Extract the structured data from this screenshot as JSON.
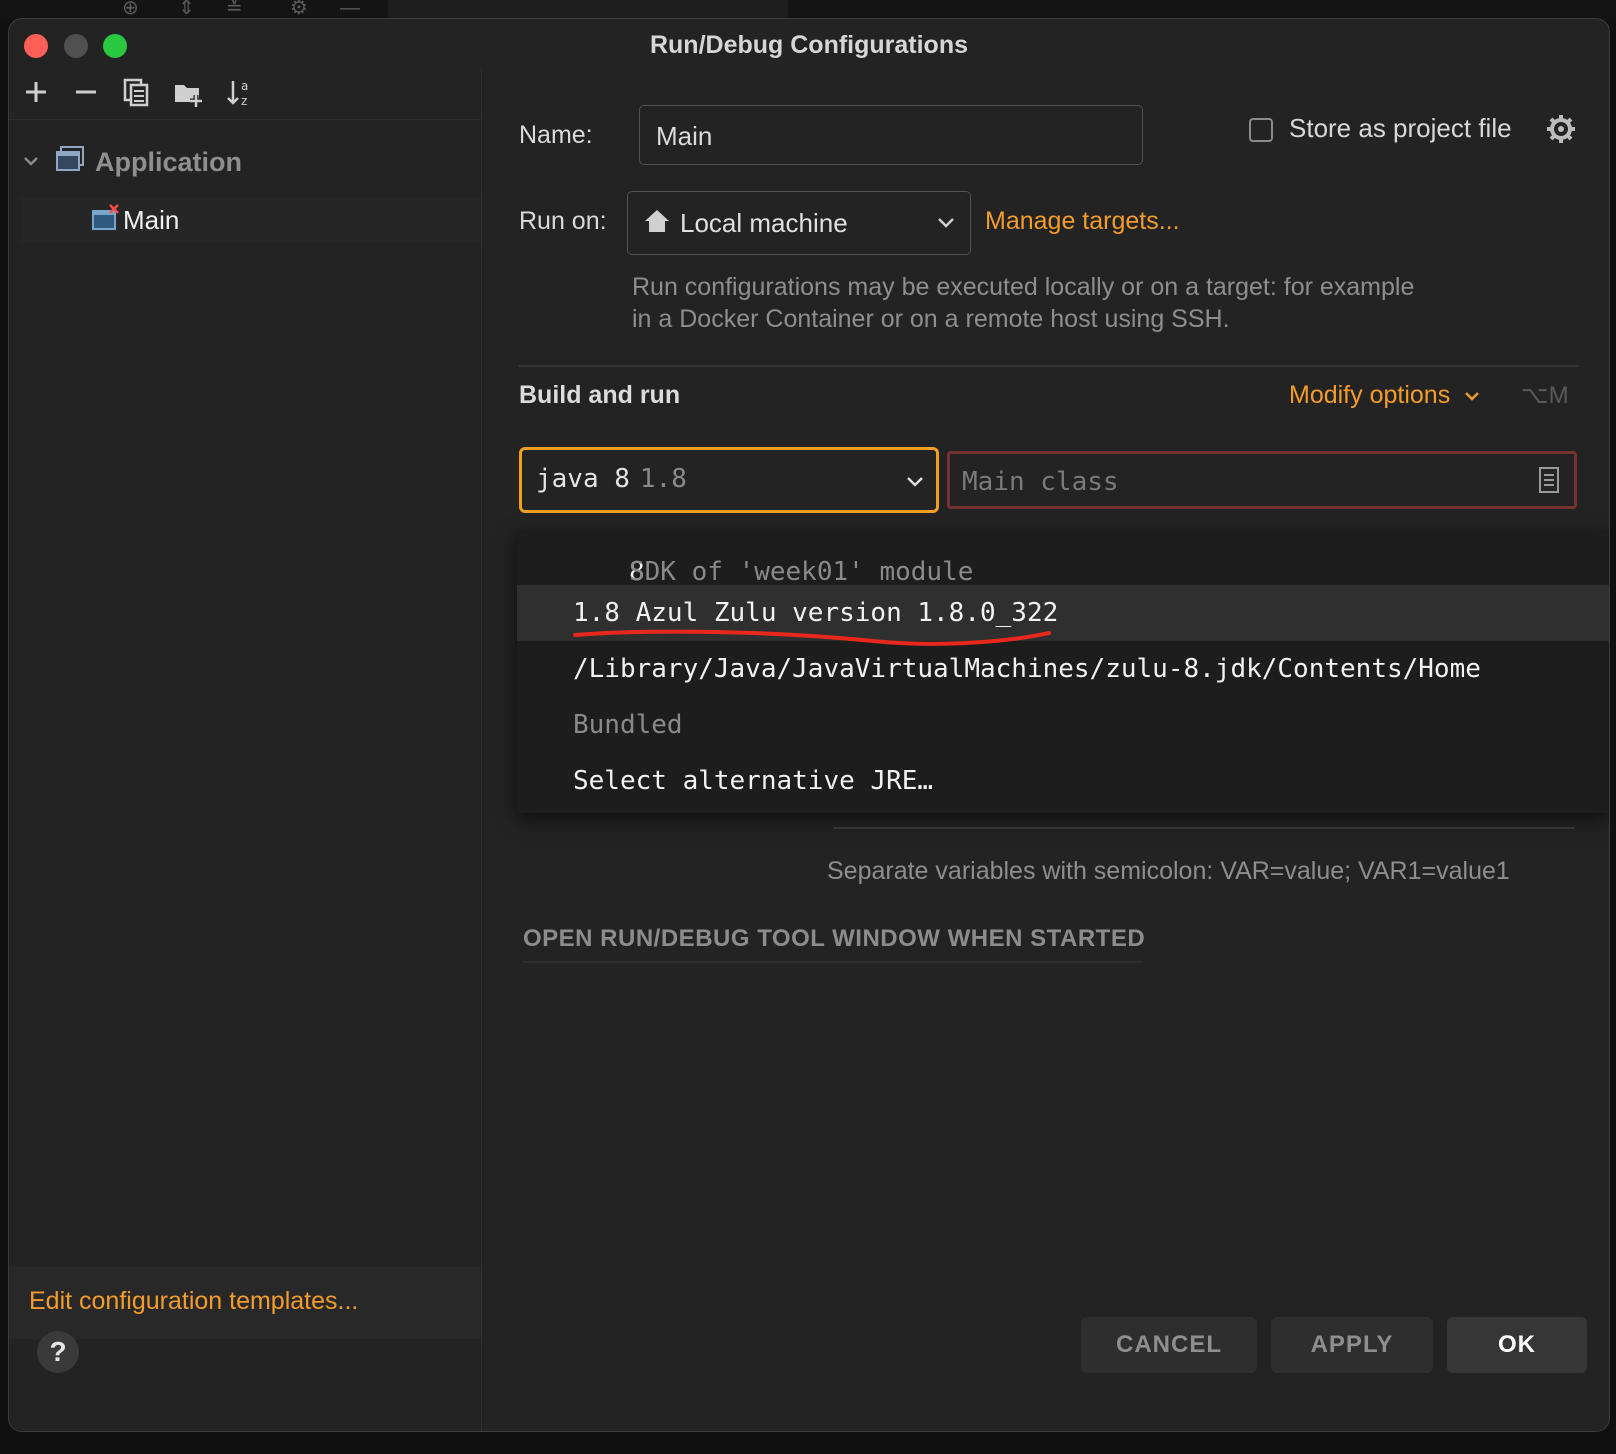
{
  "dialog": {
    "title": "Run/Debug Configurations"
  },
  "sidebar": {
    "toolbar_icons": [
      "add-icon",
      "remove-icon",
      "copy-icon",
      "folder-add-icon",
      "sort-alpha-icon"
    ],
    "tree": {
      "group": "Application",
      "items": [
        {
          "label": "Main"
        }
      ]
    },
    "edit_templates": "Edit configuration templates...",
    "help": "?"
  },
  "form": {
    "name_label": "Name:",
    "name_value": "Main",
    "store_as_project_file": "Store as project file",
    "store_checked": false,
    "run_on_label": "Run on:",
    "run_on_value": "Local machine",
    "manage_targets": "Manage targets...",
    "run_on_hint": "Run configurations may be executed locally or on a target: for example in a Docker Container or on a remote host using SSH.",
    "build_and_run": "Build and run",
    "modify_options": "Modify options",
    "modify_shortcut": "⌥M",
    "jre_value": "java 8",
    "jre_version": "1.8",
    "main_class_placeholder": "Main class",
    "env_hint": "Separate variables with semicolon: VAR=value; VAR1=value1",
    "open_tool_window": "OPEN RUN/DEBUG TOOL WINDOW WHEN STARTED"
  },
  "jre_dropdown": {
    "items": [
      {
        "primary": "8",
        "secondary": "SDK of 'week01' module"
      },
      {
        "primary": "1.8 Azul Zulu version 1.8.0_322",
        "secondary": "",
        "selected": true
      },
      {
        "primary": "/Library/Java/JavaVirtualMachines/zulu-8.jdk/Contents/Home",
        "secondary": ""
      },
      {
        "primary": "",
        "secondary": "Bundled"
      },
      {
        "primary": "Select alternative JRE…",
        "secondary": ""
      }
    ]
  },
  "buttons": {
    "cancel": "CANCEL",
    "apply": "APPLY",
    "ok": "OK"
  },
  "colors": {
    "accent": "#f39c2a",
    "focus_border": "#f0a020",
    "error_border": "#7a3131",
    "annotation": "#e8281c"
  }
}
